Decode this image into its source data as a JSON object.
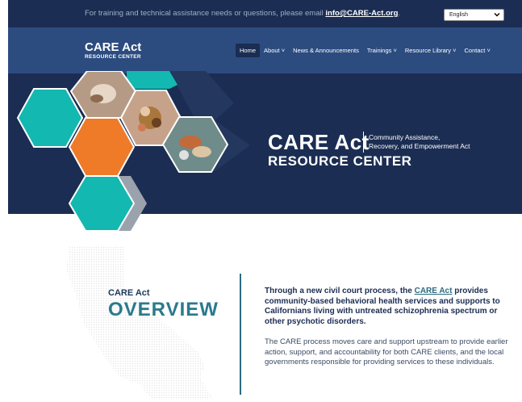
{
  "topbar": {
    "text_before": "For training and technical assistance needs or questions, please email ",
    "email": "info@CARE-Act.org",
    "text_after": "."
  },
  "language": {
    "selected": "English"
  },
  "logo": {
    "line1": "CARE Act",
    "line2": "RESOURCE CENTER"
  },
  "nav": {
    "items": [
      {
        "label": "Home",
        "has_caret": false
      },
      {
        "label": "About",
        "has_caret": true
      },
      {
        "label": "News & Announcements",
        "has_caret": false
      },
      {
        "label": "Trainings",
        "has_caret": true
      },
      {
        "label": "Resource Library",
        "has_caret": true
      },
      {
        "label": "Contact",
        "has_caret": true
      }
    ],
    "caret": "˅"
  },
  "hero": {
    "title": "CARE Act",
    "subtitle_line1": "Community Assistance,",
    "subtitle_line2": "Recovery, and Empowerment Act",
    "title2": "RESOURCE CENTER"
  },
  "overview": {
    "small_heading": "CARE Act",
    "big_heading": "OVERVIEW",
    "lead_before": "Through a new civil court process, the ",
    "lead_link": "CARE Act",
    "lead_after": " provides community-based behavioral health services and supports to Californians living with untreated schizophrenia spectrum or other psychotic disorders.",
    "body": "The CARE process moves care and support upstream to provide earlier action, support, and accountability for both CARE clients, and the local governments responsible for providing services to these individuals."
  },
  "colors": {
    "topbar": "#1b2d52",
    "nav": "#2c4c80",
    "hero": "#1b2d52",
    "teal": "#13b8b0",
    "orange": "#ef7a28",
    "heading_teal": "#2b7a8c"
  },
  "icons": {
    "language_dropdown": "chevron-down-icon"
  }
}
